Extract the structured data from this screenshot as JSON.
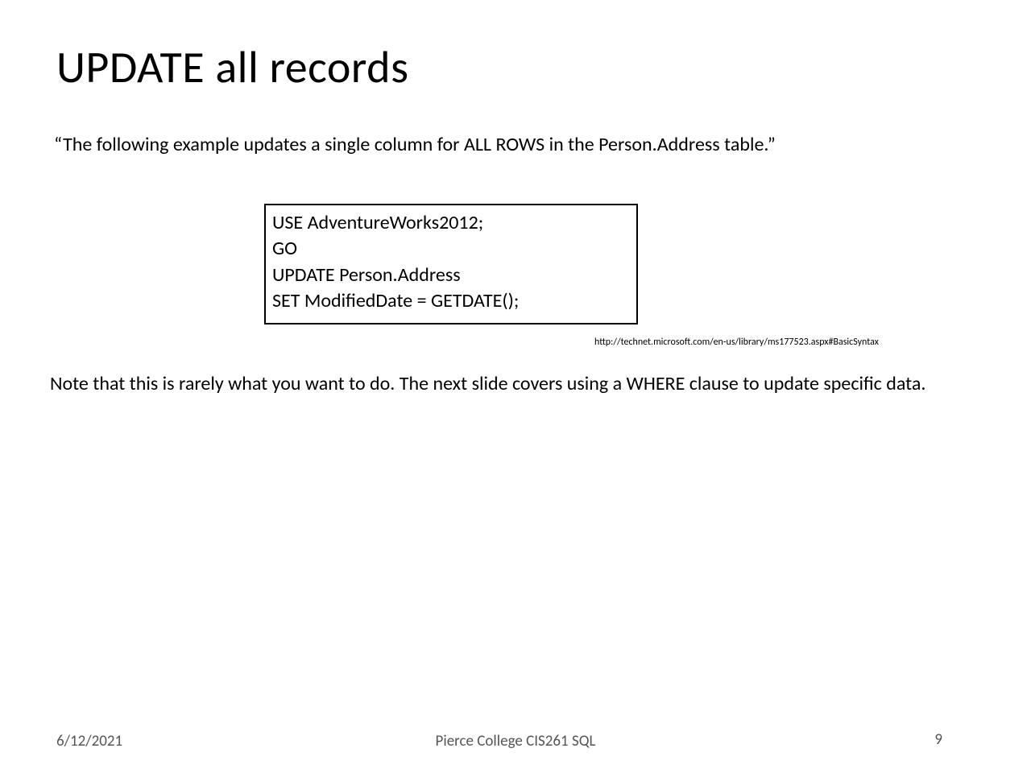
{
  "slide": {
    "title": "UPDATE all records",
    "description": "“The following example updates a single column for ALL ROWS in the Person.Address table.”",
    "code": {
      "line1": "USE AdventureWorks2012;",
      "line2": "GO",
      "line3": "UPDATE Person.Address",
      "line4": "SET ModifiedDate = GETDATE();"
    },
    "citation": "http://technet.microsoft.com/en-us/library/ms177523.aspx#BasicSyntax",
    "note": "Note that this is rarely what you want to do. The next slide covers using a WHERE clause to update specific data."
  },
  "footer": {
    "date": "6/12/2021",
    "center": "Pierce College CIS261 SQL",
    "page": "9"
  }
}
